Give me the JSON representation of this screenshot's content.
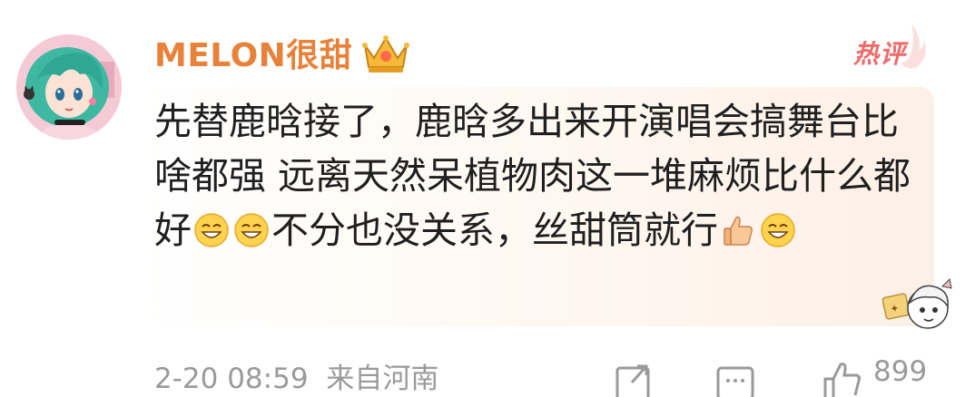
{
  "comment": {
    "username": "MELON很甜",
    "badge_icon": "crown-icon",
    "hot_badge": "热评",
    "text_part1": "先替鹿晗接了，鹿晗多出来开演唱会搞舞台比啥都强 远离天然呆植物肉这一堆麻烦比什么都好",
    "text_part2": "不分也没关系，丝甜筒就行",
    "emojis": [
      "grin-emoji",
      "grin-emoji",
      "thumbs-up-emoji",
      "grin-emoji"
    ],
    "timestamp": "2-20 08:59",
    "location": "来自河南",
    "like_count": "899"
  },
  "colors": {
    "username": "#e8823a",
    "hot_badge": "#f06a6a",
    "text": "#1f1f1f",
    "meta": "#9a9a9a",
    "bubble_tint": "#fdf0e6"
  }
}
